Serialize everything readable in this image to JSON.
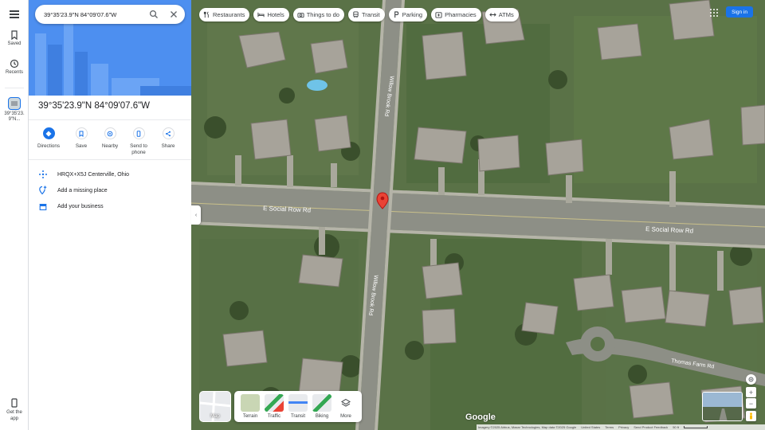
{
  "search": {
    "value": "39°35'23.9\"N 84°09'07.6\"W"
  },
  "rail": {
    "menu_icon": "menu-icon",
    "saved": "Saved",
    "recents": "Recents",
    "current_place": "39°35'23.9\"N...",
    "get_app": "Get the app"
  },
  "place": {
    "title": "39°35'23.9\"N 84°09'07.6\"W",
    "actions": [
      {
        "label": "Directions",
        "icon": "directions-icon"
      },
      {
        "label": "Save",
        "icon": "bookmark-icon"
      },
      {
        "label": "Nearby",
        "icon": "nearby-icon"
      },
      {
        "label": "Send to phone",
        "icon": "phone-icon"
      },
      {
        "label": "Share",
        "icon": "share-icon"
      }
    ],
    "plus_code": "HRQX+X5J Centerville, Ohio",
    "add_place": "Add a missing place",
    "add_business": "Add your business"
  },
  "chips": [
    {
      "label": "Restaurants",
      "icon": "fork-knife-icon"
    },
    {
      "label": "Hotels",
      "icon": "bed-icon"
    },
    {
      "label": "Things to do",
      "icon": "camera-icon"
    },
    {
      "label": "Transit",
      "icon": "train-icon"
    },
    {
      "label": "Parking",
      "icon": "parking-icon"
    },
    {
      "label": "Pharmacies",
      "icon": "pharmacy-icon"
    },
    {
      "label": "ATMs",
      "icon": "atm-icon"
    }
  ],
  "header": {
    "sign_in": "Sign in"
  },
  "layers": {
    "main": "Map",
    "items": [
      "Terrain",
      "Traffic",
      "Transit",
      "Biking",
      "More"
    ]
  },
  "map_labels": {
    "road_horizontal": "E Social Row Rd",
    "road_vertical": "Willow Brook Rd",
    "road_lower_right": "Thomas Farm Rd"
  },
  "footer": {
    "logo": "Google",
    "attribution": "Imagery ©2025 Airbus, Maxar Technologies, Map data ©2025 Google",
    "country": "United States",
    "terms": "Terms",
    "privacy": "Privacy",
    "feedback": "Send Product Feedback",
    "scale": "50 ft"
  },
  "colors": {
    "accent": "#1a73e8",
    "pin": "#ea4335",
    "hero": "#4d8ff0"
  }
}
